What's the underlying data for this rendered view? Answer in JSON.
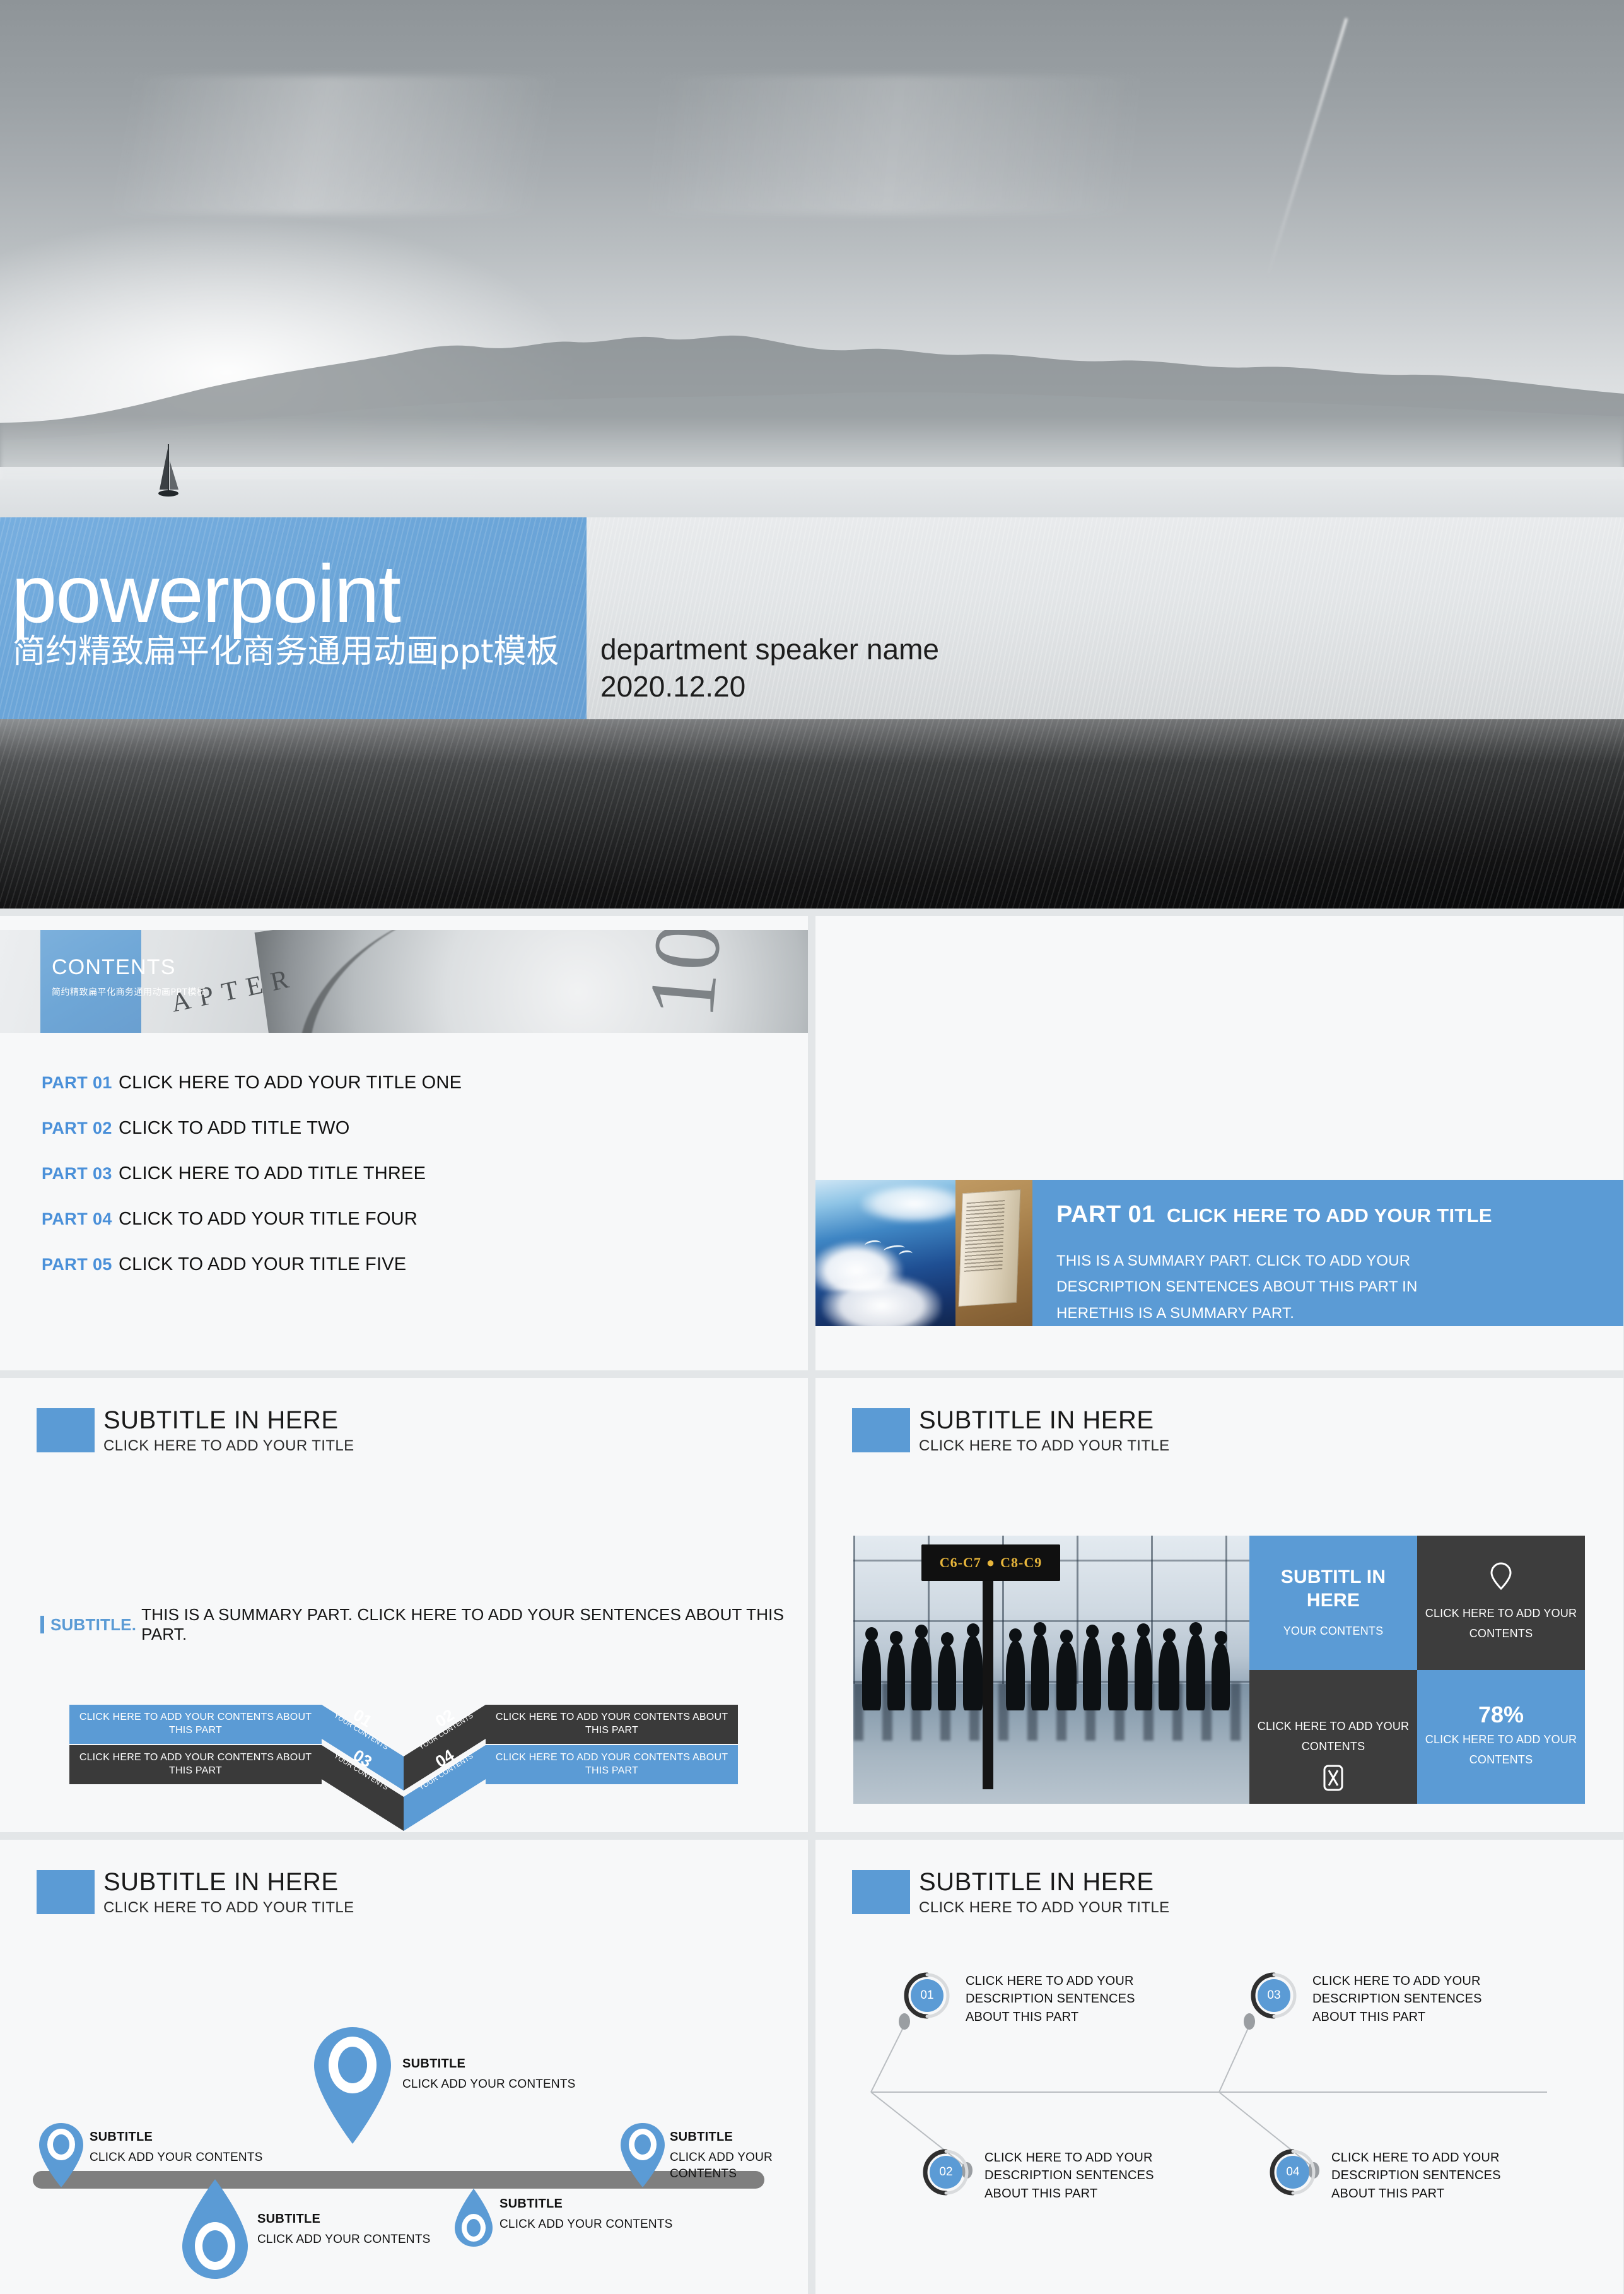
{
  "theme": {
    "accent_blue": "#5b9bd5",
    "dark": "#3a3a3a",
    "page_bg": "#f7f8f9",
    "gap": "#e3e6e8"
  },
  "slide_title": {
    "main_word": "powerpoint",
    "chinese_subtitle": "简约精致扁平化商务通用动画ppt模板",
    "speaker": "department speaker name",
    "date": "2020.12.20"
  },
  "slide_contents": {
    "banner_word": "CONTENTS",
    "banner_cn": "简约精致扁平化商务通用动画PPT模板",
    "watch_chapter_text": "APTER",
    "watch_number": "10",
    "items": [
      {
        "part": "PART 01",
        "title": "CLICK HERE TO ADD YOUR TITLE ONE"
      },
      {
        "part": "PART 02",
        "title": "CLICK TO ADD TITLE TWO"
      },
      {
        "part": "PART 03",
        "title": "CLICK HERE TO ADD TITLE THREE"
      },
      {
        "part": "PART 04",
        "title": "CLICK TO ADD  YOUR TITLE FOUR"
      },
      {
        "part": "PART 05",
        "title": "CLICK TO ADD  YOUR TITLE FIVE"
      }
    ]
  },
  "slide_part01": {
    "part_number": "PART 01",
    "part_title": "CLICK HERE TO ADD YOUR TITLE",
    "body": "THIS IS A SUMMARY PART. CLICK TO ADD YOUR DESCRIPTION SENTENCES ABOUT THIS PART IN HERETHIS IS A SUMMARY PART."
  },
  "slide_chevrons": {
    "header_title": "SUBTITLE IN HERE",
    "header_sub": "CLICK HERE TO ADD YOUR TITLE",
    "summary_keyword": "SUBTITLE.",
    "summary_text": "THIS IS A SUMMARY PART. CLICK HERE TO ADD YOUR SENTENCES ABOUT THIS PART.",
    "panels": [
      {
        "id": "01",
        "small": "YOUR CONTENTS",
        "text": "CLICK HERE TO ADD YOUR CONTENTS ABOUT THIS PART",
        "color": "blue",
        "side": "left"
      },
      {
        "id": "02",
        "small": "YOUR CONTENTS",
        "text": "CLICK HERE TO ADD YOUR CONTENTS ABOUT THIS PART",
        "color": "dark",
        "side": "right"
      },
      {
        "id": "03",
        "small": "YOUR CONTENTS",
        "text": "CLICK HERE TO ADD YOUR CONTENTS ABOUT THIS PART",
        "color": "dark",
        "side": "left"
      },
      {
        "id": "04",
        "small": "YOUR CONTENTS",
        "text": "CLICK HERE TO ADD YOUR CONTENTS ABOUT THIS PART",
        "color": "blue",
        "side": "right"
      }
    ]
  },
  "slide_photo_tiles": {
    "header_title": "SUBTITLE IN HERE",
    "header_sub": "CLICK HERE TO ADD YOUR TITLE",
    "photo_sign_left": "C6-C7",
    "photo_sign_right": "C8-C9",
    "tiles": [
      {
        "heading": "SUBTITL IN HERE",
        "sub": "YOUR CONTENTS",
        "color": "blue",
        "icon": "none"
      },
      {
        "body": "CLICK HERE TO ADD YOUR CONTENTS",
        "color": "dark",
        "icon": "location-pin-icon"
      },
      {
        "body": "CLICK HERE TO ADD YOUR CONTENTS",
        "color": "dark",
        "icon": "hourglass-icon"
      },
      {
        "percent": "78%",
        "body": "CLICK HERE TO ADD YOUR CONTENTS",
        "color": "blue",
        "icon": "none"
      }
    ]
  },
  "slide_pins": {
    "header_title": "SUBTITLE IN HERE",
    "header_sub": "CLICK HERE TO ADD YOUR TITLE",
    "pins": [
      {
        "title": "SUBTITLE",
        "body": "CLICK ADD YOUR CONTENTS",
        "size": "small",
        "position": "above-left"
      },
      {
        "title": "SUBTITLE",
        "body": "CLICK ADD YOUR CONTENTS",
        "size": "large",
        "position": "above-center"
      },
      {
        "title": "SUBTITLE",
        "body": "CLICK ADD YOUR CONTENTS",
        "size": "small",
        "position": "above-right"
      },
      {
        "title": "SUBTITLE",
        "body": "CLICK ADD YOUR CONTENTS",
        "size": "large",
        "position": "below-left"
      },
      {
        "title": "SUBTITLE",
        "body": "CLICK ADD YOUR CONTENTS",
        "size": "small",
        "position": "below-right"
      }
    ]
  },
  "slide_nodes": {
    "header_title": "SUBTITLE IN HERE",
    "header_sub": "CLICK HERE TO ADD YOUR TITLE",
    "nodes": [
      {
        "number": "01",
        "text": "CLICK HERE TO ADD YOUR\nDESCRIPTION SENTENCES\nABOUT THIS PART"
      },
      {
        "number": "02",
        "text": "CLICK HERE TO ADD YOUR\nDESCRIPTION SENTENCES\nABOUT THIS PART"
      },
      {
        "number": "03",
        "text": "CLICK HERE TO ADD YOUR\nDESCRIPTION SENTENCES\nABOUT THIS PART"
      },
      {
        "number": "04",
        "text": "CLICK HERE TO ADD YOUR\nDESCRIPTION SENTENCES\nABOUT THIS PART"
      }
    ]
  }
}
